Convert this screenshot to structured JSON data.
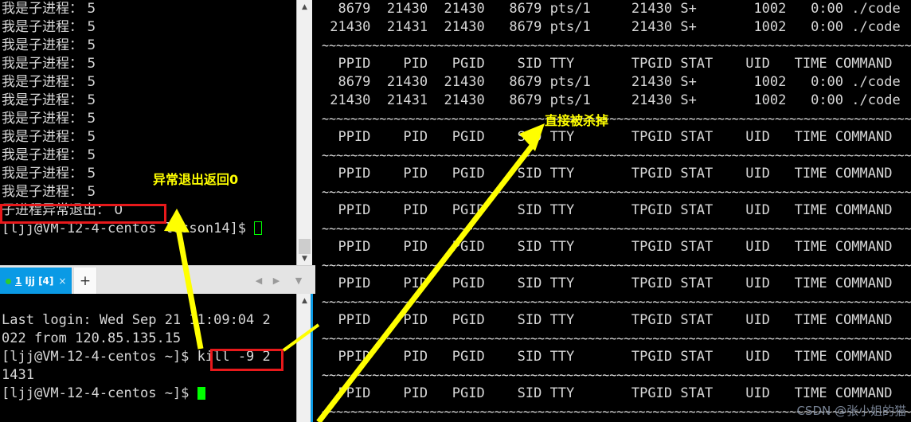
{
  "left_top_terminal": {
    "name": "child-process-output-terminal",
    "repeated_line": "我是子进程： 5",
    "repeat_count": 11,
    "exit_line": "子进程异常退出： 0",
    "prompt_line": "[ljj@VM-12-4-centos lesson14]$ ",
    "annotation": "异常退出返回0",
    "annotation_color": "#ffff00",
    "highlight_color": "#e8191b"
  },
  "tabbar": {
    "name": "terminal-tab-bar",
    "tab_index": "1",
    "tab_user": " ljj",
    "tab_count": " [4]",
    "close_glyph": "×",
    "new_tab_glyph": "+",
    "prev_glyph": "◀",
    "next_glyph": "▶",
    "menu_glyph": "▼",
    "active_color": "#0a9ae5",
    "status_dot_color": "#2ecc2e"
  },
  "left_bottom_terminal": {
    "name": "kill-command-terminal",
    "lines": [
      "Last login: Wed Sep 21 11:09:04 2",
      "022 from 120.85.135.15"
    ],
    "prompt1": "[ljj@VM-12-4-centos ~]$ ",
    "command": "kill -9",
    "command_tail": " 2",
    "wrap_tail": "1431",
    "prompt2": "[ljj@VM-12-4-centos ~]$ "
  },
  "right_terminal": {
    "name": "ps-process-watch-terminal",
    "annotation": "直接被杀掉",
    "header": "  PPID    PID   PGID    SID TTY       TPGID STAT    UID   TIME COMMAND",
    "separator": "~",
    "top_rows": [
      "  8679  21430  21430   8679 pts/1     21430 S+       1002   0:00 ./code",
      " 21430  21431  21430   8679 pts/1     21430 S+       1002   0:00 ./code"
    ],
    "second_rows": [
      "  8679  21430  21430   8679 pts/1     21430 S+       1002   0:00 ./code",
      " 21430  21431  21430   8679 pts/1     21430 S+       1002   0:00 ./code"
    ],
    "empty_header_repeats": 8,
    "columns": [
      "PPID",
      "PID",
      "PGID",
      "SID",
      "TTY",
      "TPGID",
      "STAT",
      "UID",
      "TIME",
      "COMMAND"
    ],
    "sample_process": {
      "ppid": "8679",
      "pid": "21430",
      "pgid": "21430",
      "sid": "8679",
      "tty": "pts/1",
      "tpgid": "21430",
      "stat": "S+",
      "uid": "1002",
      "time": "0:00",
      "command": "./code"
    },
    "sample_child": {
      "ppid": "21430",
      "pid": "21431",
      "pgid": "21430",
      "sid": "8679",
      "tty": "pts/1",
      "tpgid": "21430",
      "stat": "S+",
      "uid": "1002",
      "time": "0:00",
      "command": "./code"
    }
  },
  "watermark": {
    "name": "csdn-watermark",
    "text": "CSDN @张小姐的猫"
  }
}
